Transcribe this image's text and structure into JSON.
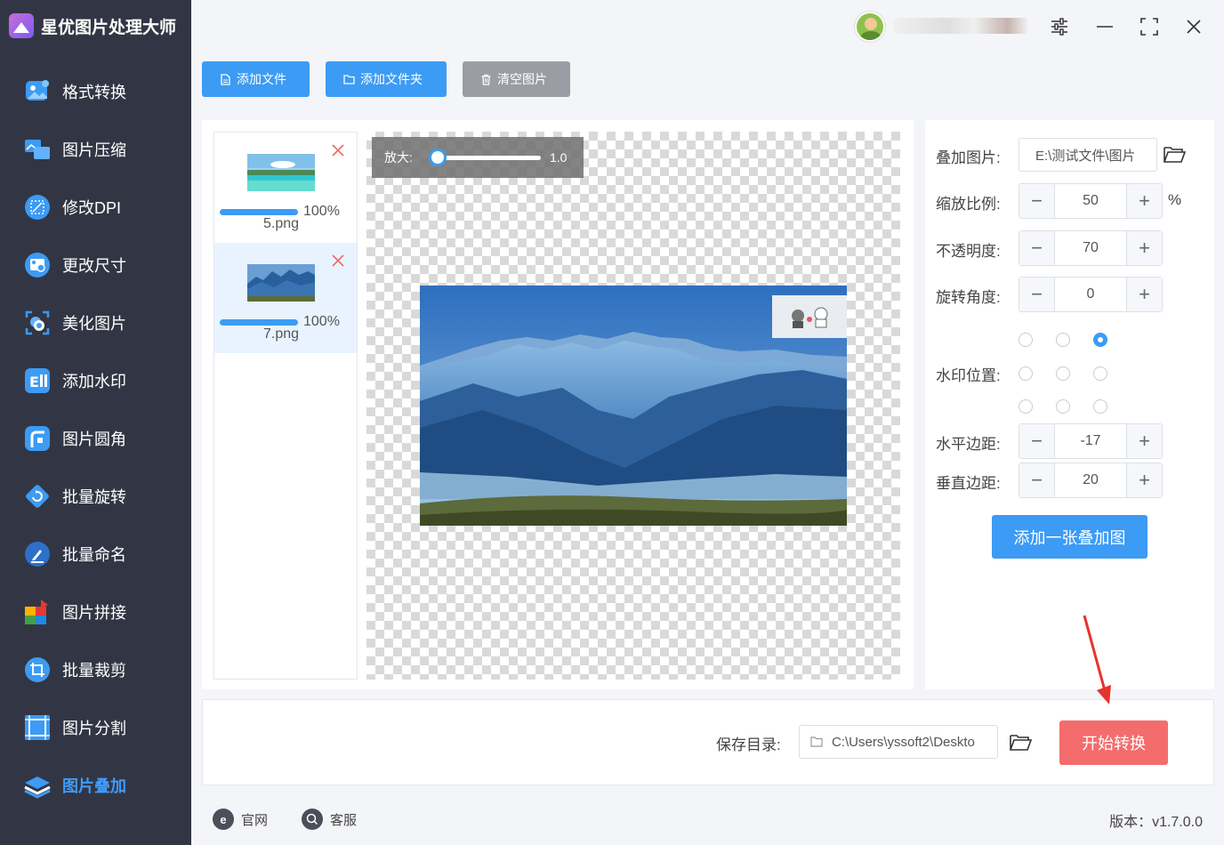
{
  "app": {
    "title": "星优图片处理大师"
  },
  "sidebar": {
    "items": [
      {
        "label": "格式转换",
        "icon": "image-convert-icon",
        "active": false
      },
      {
        "label": "图片压缩",
        "icon": "image-compress-icon",
        "active": false
      },
      {
        "label": "修改DPI",
        "icon": "dpi-icon",
        "active": false
      },
      {
        "label": "更改尺寸",
        "icon": "resize-icon",
        "active": false
      },
      {
        "label": "美化图片",
        "icon": "beautify-icon",
        "active": false
      },
      {
        "label": "添加水印",
        "icon": "watermark-icon",
        "active": false
      },
      {
        "label": "图片圆角",
        "icon": "rounded-corner-icon",
        "active": false
      },
      {
        "label": "批量旋转",
        "icon": "rotate-icon",
        "active": false
      },
      {
        "label": "批量命名",
        "icon": "rename-icon",
        "active": false
      },
      {
        "label": "图片拼接",
        "icon": "puzzle-icon",
        "active": false
      },
      {
        "label": "批量裁剪",
        "icon": "crop-icon",
        "active": false
      },
      {
        "label": "图片分割",
        "icon": "split-icon",
        "active": false
      },
      {
        "label": "图片叠加",
        "icon": "layers-icon",
        "active": true
      }
    ]
  },
  "toolbar": {
    "add_file": "添加文件",
    "add_folder": "添加文件夹",
    "clear": "清空图片"
  },
  "files": [
    {
      "name": "5.png",
      "progress": "100%",
      "progress_fraction": 1.0
    },
    {
      "name": "7.png",
      "progress": "100%",
      "progress_fraction": 1.0
    }
  ],
  "preview": {
    "zoom_label": "放大:",
    "zoom_value": "1.0"
  },
  "settings": {
    "overlay_label": "叠加图片:",
    "overlay_path": "E:\\测试文件\\图片",
    "scale_label": "缩放比例:",
    "scale_value": "50",
    "scale_unit": "%",
    "opacity_label": "不透明度:",
    "opacity_value": "70",
    "rotation_label": "旋转角度:",
    "rotation_value": "0",
    "position_label": "水印位置:",
    "position_selected": "top-right",
    "h_margin_label": "水平边距:",
    "h_margin_value": "-17",
    "v_margin_label": "垂直边距:",
    "v_margin_value": "20",
    "add_overlay_button": "添加一张叠加图"
  },
  "bottom": {
    "save_label": "保存目录:",
    "save_path": "C:\\Users\\yssoft2\\Deskto",
    "start_button": "开始转换"
  },
  "footer": {
    "website": "官网",
    "support": "客服",
    "version": "版本：v1.7.0.0"
  },
  "colors": {
    "sidebar_bg": "#323644",
    "accent": "#3c9bf4",
    "start_button": "#f56c6c",
    "arrow": "#e8322e"
  }
}
